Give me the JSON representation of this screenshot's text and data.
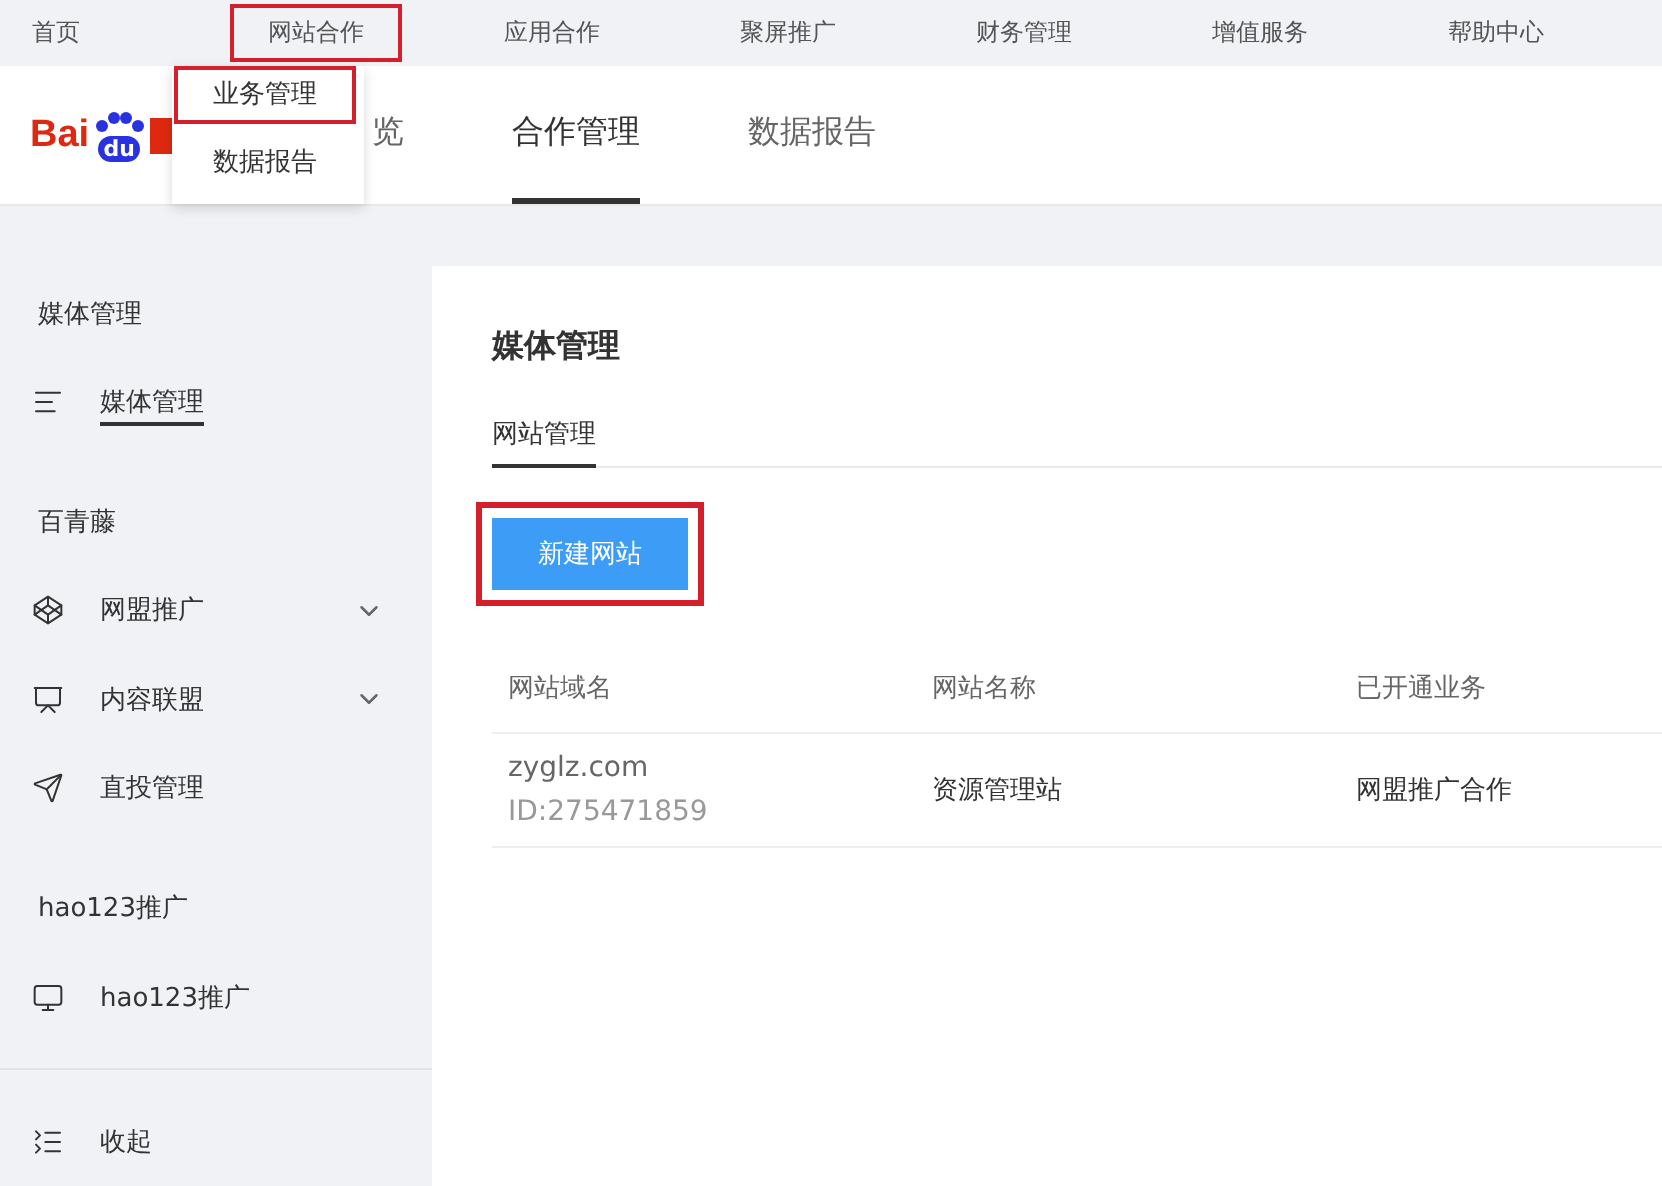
{
  "top_nav": [
    {
      "label": "首页",
      "highlighted": false
    },
    {
      "label": "网站合作",
      "highlighted": true
    },
    {
      "label": "应用合作",
      "highlighted": false
    },
    {
      "label": "聚屏推广",
      "highlighted": false
    },
    {
      "label": "财务管理",
      "highlighted": false
    },
    {
      "label": "增值服务",
      "highlighted": false
    },
    {
      "label": "帮助中心",
      "highlighted": false
    }
  ],
  "dropdown": [
    {
      "label": "业务管理",
      "highlighted": true
    },
    {
      "label": "数据报告",
      "highlighted": false
    }
  ],
  "logo": {
    "left": "Bai",
    "paw": "du"
  },
  "tabs": [
    {
      "label": "览",
      "selected": false
    },
    {
      "label": "合作管理",
      "selected": true
    },
    {
      "label": "数据报告",
      "selected": false
    }
  ],
  "sidebar": {
    "groups": [
      {
        "title": "媒体管理",
        "items": [
          {
            "label": "媒体管理",
            "selected": true,
            "expandable": false
          }
        ]
      },
      {
        "title": "百青藤",
        "items": [
          {
            "label": "网盟推广",
            "selected": false,
            "expandable": true
          },
          {
            "label": "内容联盟",
            "selected": false,
            "expandable": true
          },
          {
            "label": "直投管理",
            "selected": false,
            "expandable": false
          }
        ]
      },
      {
        "title": "hao123推广",
        "items": [
          {
            "label": "hao123推广",
            "selected": false,
            "expandable": false
          }
        ]
      }
    ],
    "collapse": "收起"
  },
  "main": {
    "title": "媒体管理",
    "subtabs": [
      {
        "label": "网站管理",
        "selected": true
      }
    ],
    "new_button": {
      "label": "新建网站",
      "highlighted": true
    },
    "table": {
      "columns": [
        "网站域名",
        "网站名称",
        "已开通业务"
      ],
      "rows": [
        {
          "domain": "zyglz.com",
          "id": "ID:275471859",
          "name": "资源管理站",
          "services": "网盟推广合作"
        }
      ]
    }
  }
}
